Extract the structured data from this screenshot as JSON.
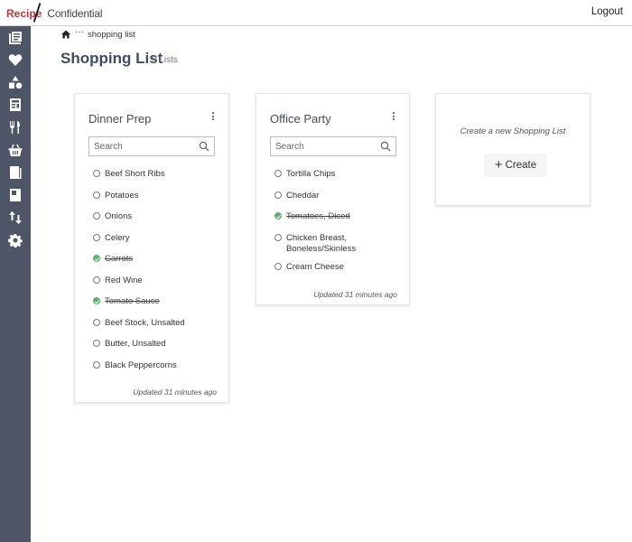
{
  "app": {
    "logo_part1": "Recipe",
    "logo_part2": "Confidential",
    "logout_label": "Logout"
  },
  "sidebar": {
    "items": [
      {
        "icon": "recipes-icon"
      },
      {
        "icon": "heart-icon"
      },
      {
        "icon": "shapes-icon"
      },
      {
        "icon": "meal-plan-icon"
      },
      {
        "icon": "utensils-icon"
      },
      {
        "icon": "basket-icon"
      },
      {
        "icon": "cookbook-icon"
      },
      {
        "icon": "book-icon"
      },
      {
        "icon": "import-export-icon"
      },
      {
        "icon": "gear-icon"
      }
    ]
  },
  "breadcrumb": {
    "home_icon": "home-icon",
    "ellipsis": "···",
    "current": "shopping list"
  },
  "header": {
    "title": "Shopping List",
    "count": "2 Lists"
  },
  "lists": [
    {
      "name": "Dinner Prep",
      "search_placeholder": "Search",
      "items": [
        {
          "label": "Beef Short Ribs",
          "checked": false
        },
        {
          "label": "Potatoes",
          "checked": false
        },
        {
          "label": "Onions",
          "checked": false
        },
        {
          "label": "Celery",
          "checked": false
        },
        {
          "label": "Carrots",
          "checked": true
        },
        {
          "label": "Red Wine",
          "checked": false
        },
        {
          "label": "Tomato Sauce",
          "checked": true
        },
        {
          "label": "Beef Stock, Unsalted",
          "checked": false
        },
        {
          "label": "Butter, Unsalted",
          "checked": false
        },
        {
          "label": "Black Peppercorns",
          "checked": false
        }
      ],
      "updated": "Updated 31 minutes ago"
    },
    {
      "name": "Office Party",
      "search_placeholder": "Search",
      "items": [
        {
          "label": "Tortilla Chips",
          "checked": false
        },
        {
          "label": "Cheddar",
          "checked": false
        },
        {
          "label": "Tomatoes, Diced",
          "checked": true
        },
        {
          "label": "Chicken Breast, Boneless/Skinless",
          "checked": false
        },
        {
          "label": "Cream Cheese",
          "checked": false
        }
      ],
      "updated": "Updated 31 minutes ago"
    }
  ],
  "new_list": {
    "prompt": "Create a new Shopping List",
    "create_label": "Create"
  },
  "colors": {
    "sidebar_bg": "#4d5566",
    "brand_red": "#c0343b",
    "title_blue": "#3e4d63",
    "check_green": "#5bb06a"
  }
}
